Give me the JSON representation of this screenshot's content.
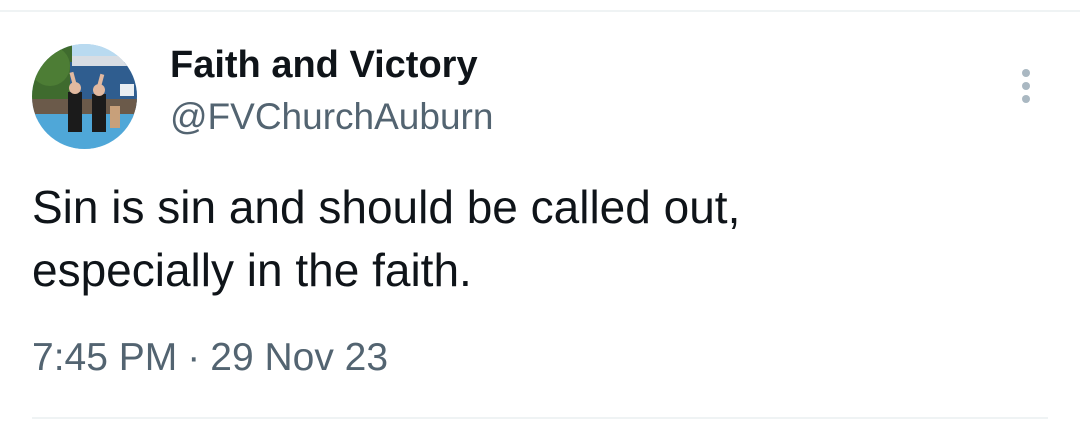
{
  "tweet": {
    "author": {
      "display_name": "Faith and Victory",
      "handle": "@FVChurchAuburn",
      "avatar_icon": "profile-photo"
    },
    "text": "Sin is sin and should be called out,\nespecially in the faith.",
    "time": "7:45 PM",
    "separator": "·",
    "date": "29 Nov 23",
    "more_icon": "vertical-ellipsis-icon"
  },
  "colors": {
    "primary_text": "#0f1419",
    "secondary_text": "#536471",
    "divider": "#eff3f4",
    "more_icon": "#aab8c2"
  }
}
